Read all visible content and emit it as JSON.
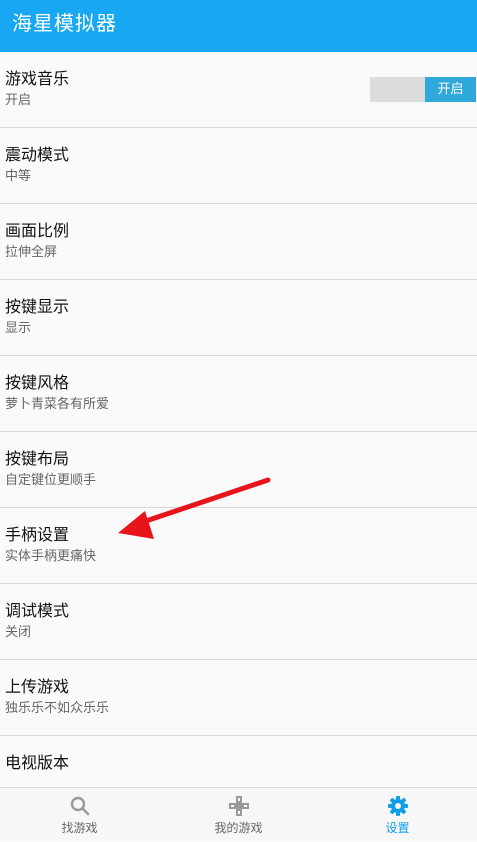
{
  "app": {
    "title": "海星模拟器"
  },
  "settings": [
    {
      "title": "游戏音乐",
      "subtitle": "开启",
      "toggle_label": "开启"
    },
    {
      "title": "震动模式",
      "subtitle": "中等"
    },
    {
      "title": "画面比例",
      "subtitle": "拉伸全屏"
    },
    {
      "title": "按键显示",
      "subtitle": "显示"
    },
    {
      "title": "按键风格",
      "subtitle": "萝卜青菜各有所爱"
    },
    {
      "title": "按键布局",
      "subtitle": "自定键位更顺手"
    },
    {
      "title": "手柄设置",
      "subtitle": "实体手柄更痛快"
    },
    {
      "title": "调试模式",
      "subtitle": "关闭"
    },
    {
      "title": "上传游戏",
      "subtitle": "独乐乐不如众乐乐"
    },
    {
      "title": "电视版本",
      "subtitle": ""
    }
  ],
  "nav": [
    {
      "label": "找游戏",
      "icon": "search-icon"
    },
    {
      "label": "我的游戏",
      "icon": "gamepad-icon"
    },
    {
      "label": "设置",
      "icon": "gear-icon",
      "active": true
    }
  ],
  "colors": {
    "app_bar": "#18a7f2",
    "toggle_on": "#2fa9d9",
    "active_nav": "#0e9fe6",
    "annotation_arrow": "#e8141b"
  }
}
